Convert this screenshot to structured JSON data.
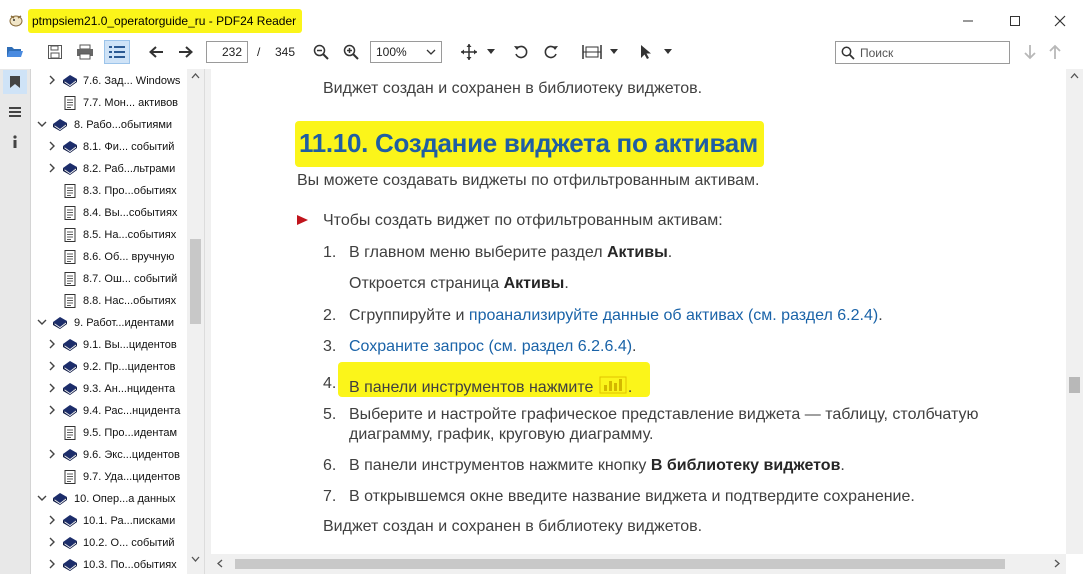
{
  "window": {
    "title": "ptmpsiem21.0_operatorguide_ru - PDF24 Reader"
  },
  "toolbar": {
    "current_page": "232",
    "page_separator": "/",
    "total_pages": "345",
    "zoom": "100%",
    "search_placeholder": "Поиск"
  },
  "outline": {
    "items": [
      {
        "label": "7.6. Зад... Windows",
        "level": 2,
        "expandable": true,
        "icon": "book"
      },
      {
        "label": "7.7. Мон... активов",
        "level": 2,
        "expandable": false,
        "icon": "page"
      },
      {
        "label": "8. Рабо...обытиями",
        "level": 1,
        "expandable": true,
        "expanded": true,
        "icon": "book"
      },
      {
        "label": "8.1. Фи... событий",
        "level": 2,
        "expandable": true,
        "icon": "book"
      },
      {
        "label": "8.2. Раб...льтрами",
        "level": 2,
        "expandable": true,
        "icon": "book"
      },
      {
        "label": "8.3. Про...обытиях",
        "level": 2,
        "expandable": false,
        "icon": "page"
      },
      {
        "label": "8.4. Вы...событиях",
        "level": 2,
        "expandable": false,
        "icon": "page"
      },
      {
        "label": "8.5. На...событиях",
        "level": 2,
        "expandable": false,
        "icon": "page"
      },
      {
        "label": "8.6. Об... вручную",
        "level": 2,
        "expandable": false,
        "icon": "page"
      },
      {
        "label": "8.7. Ош... событий",
        "level": 2,
        "expandable": false,
        "icon": "page"
      },
      {
        "label": "8.8. Нас...обытиях",
        "level": 2,
        "expandable": false,
        "icon": "page"
      },
      {
        "label": "9. Работ...идентами",
        "level": 1,
        "expandable": true,
        "expanded": true,
        "icon": "book"
      },
      {
        "label": "9.1. Вы...цидентов",
        "level": 2,
        "expandable": true,
        "icon": "book"
      },
      {
        "label": "9.2. Пр...цидентов",
        "level": 2,
        "expandable": true,
        "icon": "book"
      },
      {
        "label": "9.3. Ан...нцидента",
        "level": 2,
        "expandable": true,
        "icon": "book"
      },
      {
        "label": "9.4. Рас...нцидента",
        "level": 2,
        "expandable": true,
        "icon": "book"
      },
      {
        "label": "9.5. Про...идентам",
        "level": 2,
        "expandable": false,
        "icon": "page"
      },
      {
        "label": "9.6. Экс...цидентов",
        "level": 2,
        "expandable": true,
        "icon": "book"
      },
      {
        "label": "9.7. Уда...цидентов",
        "level": 2,
        "expandable": false,
        "icon": "page"
      },
      {
        "label": "10. Опер...а данных",
        "level": 1,
        "expandable": true,
        "expanded": true,
        "icon": "book"
      },
      {
        "label": "10.1. Ра...писками",
        "level": 2,
        "expandable": true,
        "icon": "book"
      },
      {
        "label": "10.2. О... событий",
        "level": 2,
        "expandable": true,
        "icon": "book"
      },
      {
        "label": "10.3. По...обытиях",
        "level": 2,
        "expandable": true,
        "icon": "book"
      }
    ]
  },
  "document": {
    "prev_text": "Виджет создан и сохранен в библиотеку виджетов.",
    "heading": "11.10. Создание виджета по активам",
    "intro": "Вы можете создавать виджеты по отфильтрованным активам.",
    "procedure_intro": "Чтобы создать виджет по отфильтрованным активам:",
    "steps": {
      "s1": {
        "num": "1.",
        "text": "В главном меню выберите раздел ",
        "bold": "Активы",
        "end": "."
      },
      "s1_sub": {
        "text": "Откроется страница ",
        "bold": "Активы",
        "end": "."
      },
      "s2": {
        "num": "2.",
        "text": "Сгруппируйте и ",
        "link": "проанализируйте данные об активах (см. раздел 6.2.4)",
        "end": "."
      },
      "s3": {
        "num": "3.",
        "link": "Сохраните запрос (см. раздел 6.2.6.4)",
        "end": "."
      },
      "s4": {
        "num": "4.",
        "text": "В панели инструментов нажмите ",
        "end": "."
      },
      "s5": {
        "num": "5.",
        "line1": "Выберите и настройте графическое представление виджета — таблицу, столбчатую",
        "line2": "диаграмму, график, круговую диаграмму."
      },
      "s6": {
        "num": "6.",
        "text": "В панели инструментов нажмите кнопку ",
        "bold": "В библиотеку виджетов",
        "end": "."
      },
      "s7": {
        "num": "7.",
        "text": "В открывшемся окне введите название виджета и подтвердите сохранение."
      }
    },
    "result": "Виджет создан и сохранен в библиотеку виджетов."
  },
  "colors": {
    "highlight": "#fbf51a",
    "heading": "#1f5ea3",
    "link": "#1a63a8",
    "bullet": "#c0141c",
    "book_icon": "#1c2d6b"
  }
}
